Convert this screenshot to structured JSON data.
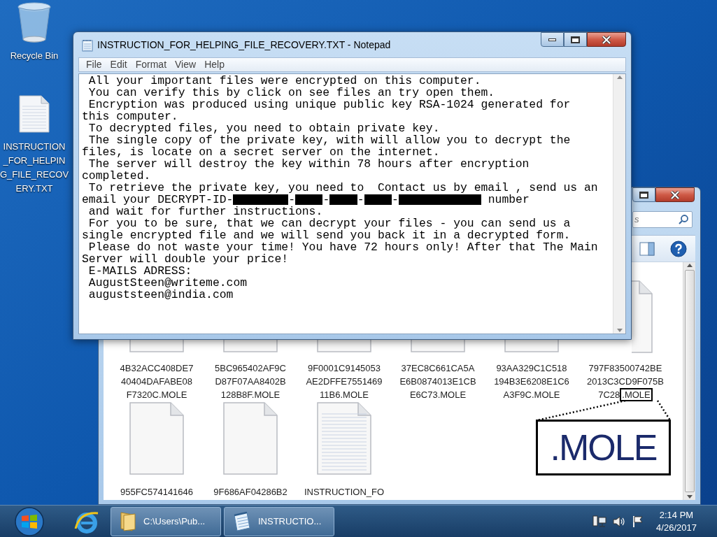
{
  "desktop_icons": [
    {
      "kind": "recycle_bin",
      "label_lines": [
        "Recycle Bin"
      ]
    },
    {
      "kind": "text_file",
      "label_lines": [
        "INSTRUCTION",
        "_FOR_HELPIN",
        "G_FILE_RECOV",
        "ERY.TXT"
      ]
    }
  ],
  "explorer": {
    "search": {
      "placeholder": "s"
    },
    "files": [
      {
        "kind": "blank",
        "name_lines": [
          [
            {
              "text": "4B32ACC408DE7"
            }
          ],
          [
            {
              "text": "40404DAFABE08"
            }
          ],
          [
            {
              "text": "F7320C.MOLE"
            }
          ]
        ]
      },
      {
        "kind": "blank",
        "name_lines": [
          [
            {
              "text": "5BC965402AF9C"
            }
          ],
          [
            {
              "text": "D87F07AA8402B"
            }
          ],
          [
            {
              "text": "128B8F.MOLE"
            }
          ]
        ]
      },
      {
        "kind": "blank",
        "name_lines": [
          [
            {
              "text": "9F0001C9145053"
            }
          ],
          [
            {
              "text": "AE2DFFE7551469"
            }
          ],
          [
            {
              "text": "11B6.MOLE"
            }
          ]
        ]
      },
      {
        "kind": "blank",
        "name_lines": [
          [
            {
              "text": "37EC8C661CA5A"
            }
          ],
          [
            {
              "text": "E6B0874013E1CB"
            }
          ],
          [
            {
              "text": "E6C73.MOLE"
            }
          ]
        ]
      },
      {
        "kind": "blank",
        "name_lines": [
          [
            {
              "text": "93AA329C1C518"
            }
          ],
          [
            {
              "text": "194B3E6208E1C6"
            }
          ],
          [
            {
              "text": "A3F9C.MOLE"
            }
          ]
        ]
      },
      {
        "kind": "blank",
        "name_lines": [
          [
            {
              "text": "797F83500742BE"
            }
          ],
          [
            {
              "text": "2013C3CD9F075B"
            }
          ],
          [
            {
              "text": "7C28"
            },
            {
              "text": ".MOLE",
              "boxed": true
            }
          ]
        ]
      },
      {
        "kind": "blank",
        "name_lines": [
          [
            {
              "text": "955FC574141646"
            }
          ]
        ]
      },
      {
        "kind": "blank",
        "name_lines": [
          [
            {
              "text": "9F686AF04286B2"
            }
          ]
        ]
      },
      {
        "kind": "text",
        "name_lines": [
          [
            {
              "text": "INSTRUCTION_FO"
            }
          ]
        ]
      }
    ]
  },
  "magnifier": {
    "text": ".MOLE"
  },
  "notepad": {
    "title": "INSTRUCTION_FOR_HELPING_FILE_RECOVERY.TXT - Notepad",
    "menu": [
      "File",
      "Edit",
      "Format",
      "View",
      "Help"
    ],
    "lines": [
      [
        {
          "kind": "text",
          "text": " All your important files were encrypted on this computer."
        }
      ],
      [
        {
          "kind": "text",
          "text": " You can verify this by click on see files an try open them."
        }
      ],
      [
        {
          "kind": "text",
          "text": " Encryption was produced using unique public key RSA-1024 generated for"
        }
      ],
      [
        {
          "kind": "text",
          "text": "this computer."
        }
      ],
      [
        {
          "kind": "text",
          "text": " To decrypted files, you need to obtain private key."
        }
      ],
      [
        {
          "kind": "text",
          "text": " The single copy of the private key, with will allow you to decrypt the"
        }
      ],
      [
        {
          "kind": "text",
          "text": "files, is locate on a secret server on the internet."
        }
      ],
      [
        {
          "kind": "text",
          "text": " The server will destroy the key within 78 hours after encryption"
        }
      ],
      [
        {
          "kind": "text",
          "text": "completed."
        }
      ],
      [
        {
          "kind": "text",
          "text": " To retrieve the private key, you need to  Contact us by email , send us an"
        }
      ],
      [
        {
          "kind": "text",
          "text": "email your DECRYPT-ID-"
        },
        {
          "kind": "redacted"
        },
        {
          "kind": "text",
          "text": "-"
        },
        {
          "kind": "redacted"
        },
        {
          "kind": "text",
          "text": "-"
        },
        {
          "kind": "redacted"
        },
        {
          "kind": "text",
          "text": "-"
        },
        {
          "kind": "redacted"
        },
        {
          "kind": "text",
          "text": "-"
        },
        {
          "kind": "redacted"
        },
        {
          "kind": "text",
          "text": " number"
        }
      ],
      [
        {
          "kind": "text",
          "text": " and wait for further instructions."
        }
      ],
      [
        {
          "kind": "text",
          "text": " For you to be sure, that we can decrypt your files - you can send us a"
        }
      ],
      [
        {
          "kind": "text",
          "text": "single encrypted file and we will send you back it in a decrypted form."
        }
      ],
      [
        {
          "kind": "text",
          "text": " Please do not waste your time! You have 72 hours only! After that The Main"
        }
      ],
      [
        {
          "kind": "text",
          "text": "Server will double your price!"
        }
      ],
      [
        {
          "kind": "text",
          "text": " E-MAILS ADRESS:"
        }
      ],
      [
        {
          "kind": "text",
          "text": " AugustSteen@writeme.com"
        }
      ],
      [
        {
          "kind": "text",
          "text": " auguststeen@india.com"
        }
      ]
    ]
  },
  "taskbar": {
    "buttons": [
      {
        "kind": "folder",
        "label": "C:\\Users\\Pub..."
      },
      {
        "kind": "notepad",
        "label": "INSTRUCTIO..."
      }
    ],
    "clock": {
      "time": "2:14 PM",
      "date": "4/26/2017"
    }
  }
}
